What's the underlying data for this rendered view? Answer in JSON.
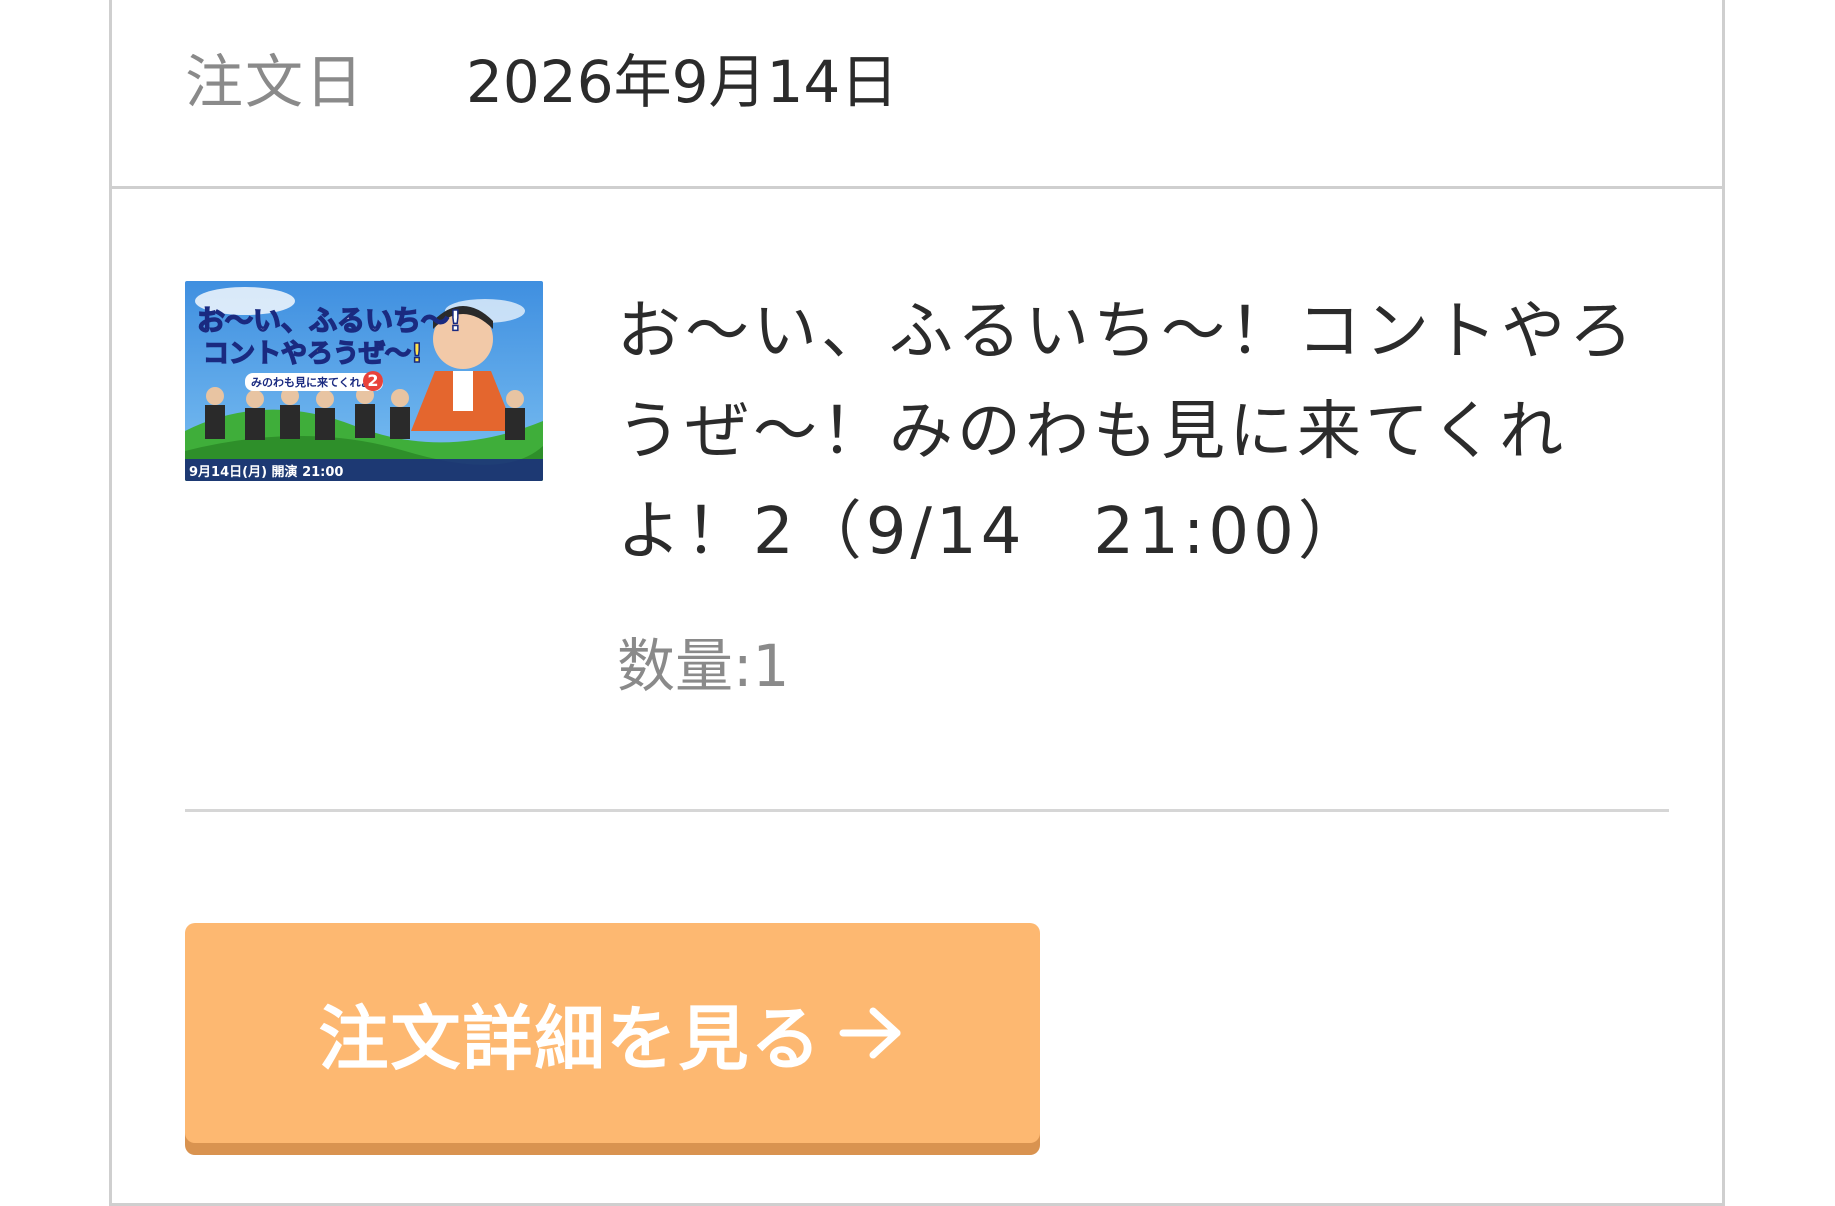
{
  "order": {
    "date_label": "注文日",
    "date_value": "2026年9月14日"
  },
  "product": {
    "title": "お〜い、ふるいち〜！コントやろうぜ〜！みのわも見に来てくれよ！2（9/14　21:00）",
    "quantity": "数量:1",
    "thumbnail": {
      "line1": "お〜い、ふるいち〜!",
      "line2": "コントやろうぜ〜!",
      "subtitle": "みのわも見に来てくれよ!",
      "number": "2",
      "bottom": "9月14日(月) 開演 21:00"
    }
  },
  "actions": {
    "detail_button_label": "注文詳細を見る"
  },
  "colors": {
    "button_bg": "#fdb871",
    "button_shadow": "#d99350",
    "border": "#cfcfcf",
    "label_gray": "#8a8a8a",
    "text_dark": "#2b2b2b"
  },
  "icons": {
    "button_arrow": "arrow-right-icon"
  }
}
